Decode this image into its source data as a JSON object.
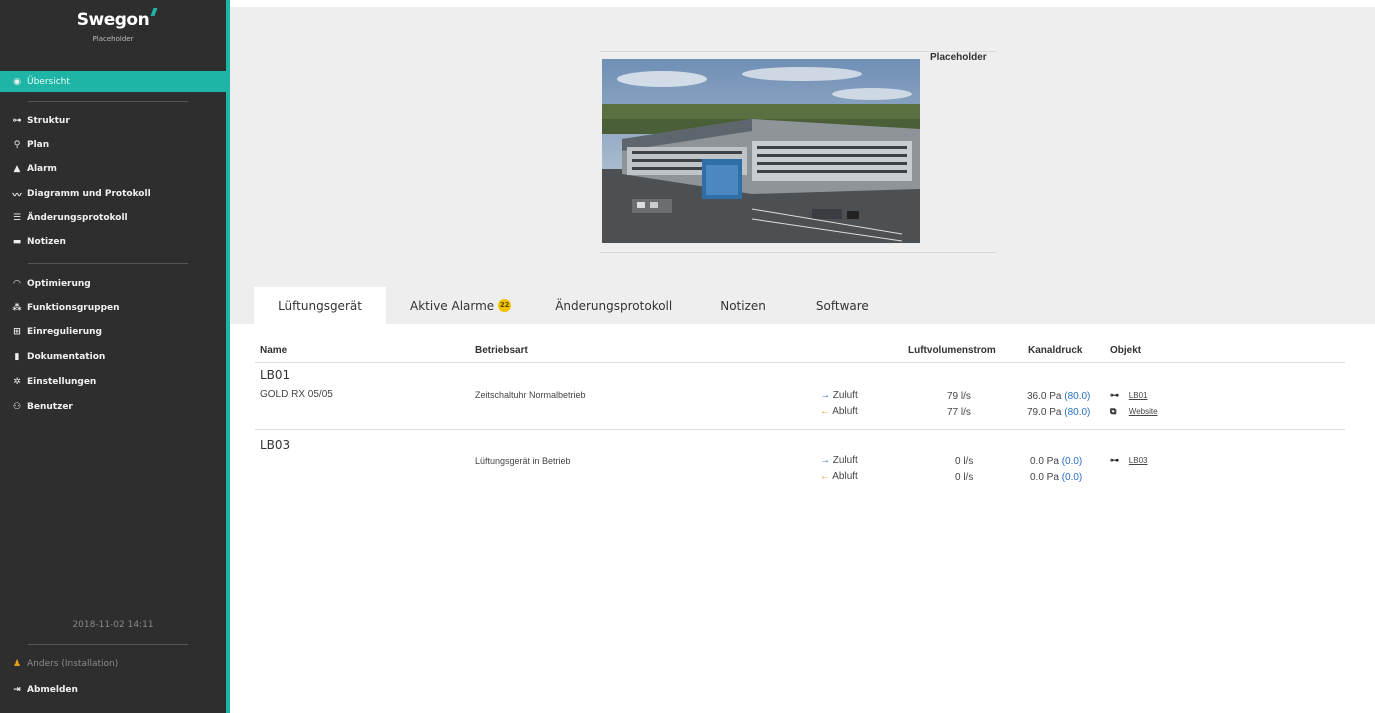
{
  "brand": {
    "logo": "Swegon",
    "subtitle": "Placeholder",
    "accent_color": "#1fb5a6"
  },
  "sidebar": {
    "active": {
      "label": "Übersicht",
      "icon": "eye-icon"
    },
    "group1": [
      {
        "label": "Struktur",
        "icon": "structure-icon"
      },
      {
        "label": "Plan",
        "icon": "map-pin-icon"
      },
      {
        "label": "Alarm",
        "icon": "bell-icon"
      },
      {
        "label": "Diagramm und Protokoll",
        "icon": "chart-icon"
      },
      {
        "label": "Änderungsprotokoll",
        "icon": "list-icon"
      },
      {
        "label": "Notizen",
        "icon": "comment-icon"
      }
    ],
    "group2": [
      {
        "label": "Optimierung",
        "icon": "gauge-icon"
      },
      {
        "label": "Funktionsgruppen",
        "icon": "sitemap-icon"
      },
      {
        "label": "Einregulierung",
        "icon": "adjust-icon"
      },
      {
        "label": "Dokumentation",
        "icon": "document-icon"
      },
      {
        "label": "Einstellungen",
        "icon": "gear-icon"
      },
      {
        "label": "Benutzer",
        "icon": "users-icon"
      }
    ],
    "timestamp": "2018-11-02 14:11",
    "user": "Anders (Installation)",
    "logout": "Abmelden"
  },
  "header": {
    "photo_caption": "Placeholder"
  },
  "tabs": [
    {
      "label": "Lüftungsgerät",
      "active": true
    },
    {
      "label": "Aktive Alarme",
      "badge": "22"
    },
    {
      "label": "Änderungsprotokoll"
    },
    {
      "label": "Notizen"
    },
    {
      "label": "Software"
    }
  ],
  "table": {
    "columns": {
      "name": "Name",
      "mode": "Betriebsart",
      "flow": "Luftvolumenstrom",
      "pressure": "Kanaldruck",
      "object": "Objekt"
    },
    "rows": [
      {
        "name": "LB01",
        "model": "GOLD RX 05/05",
        "mode": "Zeitschaltuhr Normalbetrieb",
        "supply_label": "Zuluft",
        "exhaust_label": "Abluft",
        "supply_flow": "79 l/s",
        "exhaust_flow": "77 l/s",
        "supply_pressure": "36.0 Pa",
        "supply_setpoint": "(80.0)",
        "exhaust_pressure": "79.0 Pa",
        "exhaust_setpoint": "(80.0)",
        "object_link": "LB01",
        "website_link": "Website"
      },
      {
        "name": "LB03",
        "model": "",
        "mode": "Lüftungsgerät in Betrieb",
        "supply_label": "Zuluft",
        "exhaust_label": "Abluft",
        "supply_flow": "0 l/s",
        "exhaust_flow": "0 l/s",
        "supply_pressure": "0.0 Pa",
        "supply_setpoint": "(0.0)",
        "exhaust_pressure": "0.0 Pa",
        "exhaust_setpoint": "(0.0)",
        "object_link": "LB03"
      }
    ]
  }
}
